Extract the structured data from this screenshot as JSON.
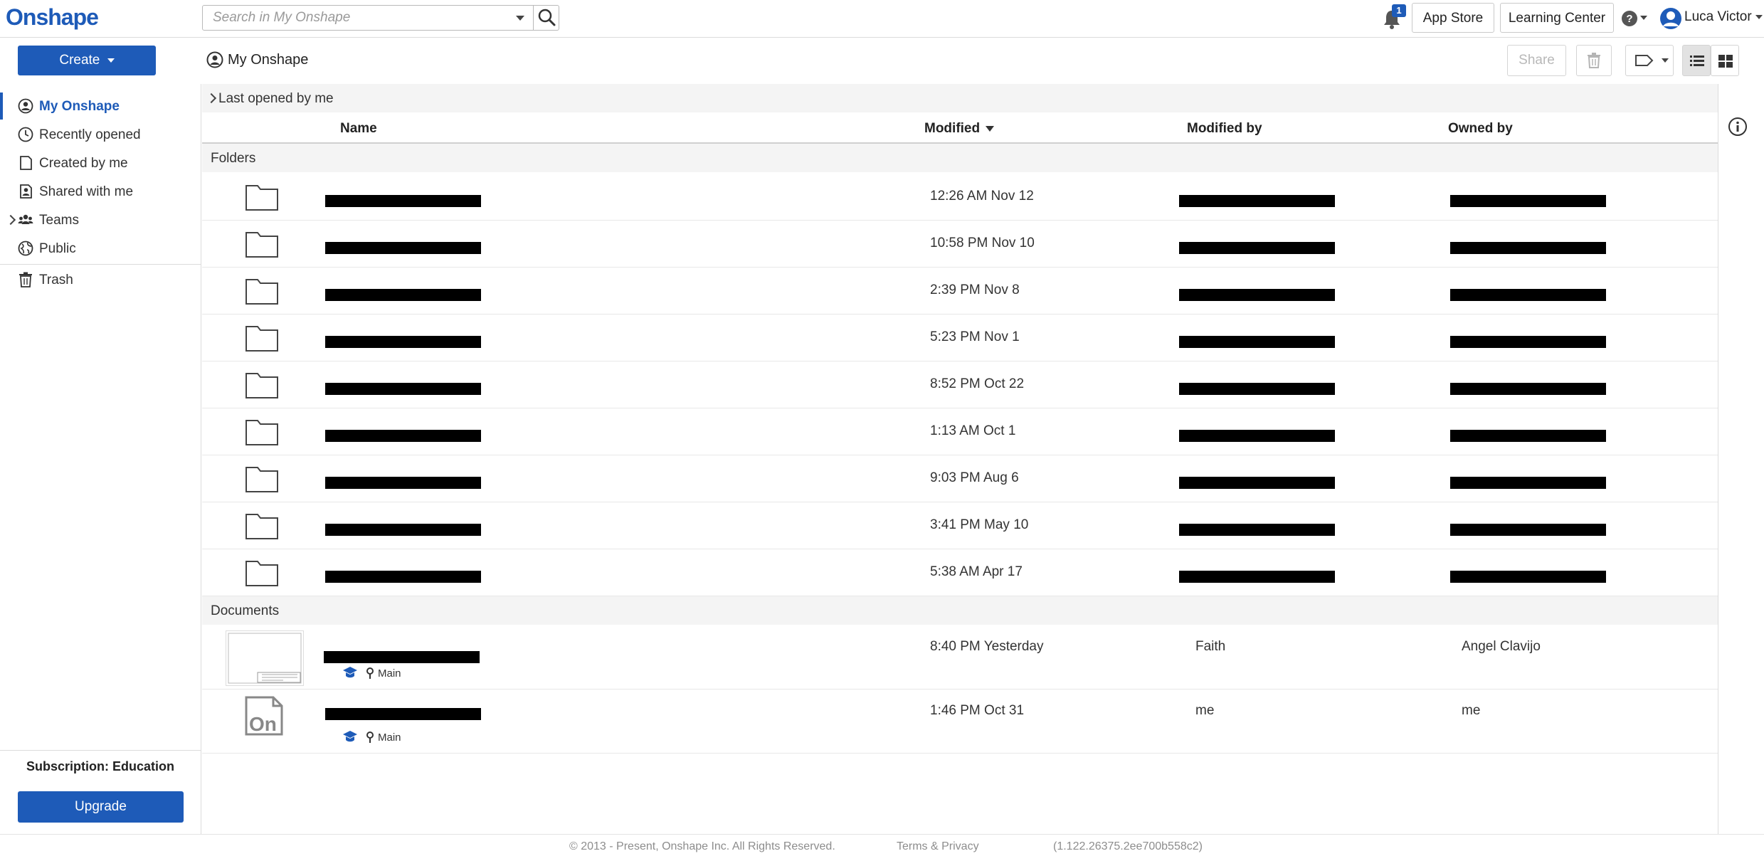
{
  "app": {
    "logo": "Onshape"
  },
  "search": {
    "placeholder": "Search in My Onshape"
  },
  "notifications": {
    "count": "1"
  },
  "header": {
    "app_store": "App Store",
    "learning_center": "Learning Center",
    "user_name": "Luca Victor"
  },
  "toolbar": {
    "create_label": "Create",
    "share_label": "Share"
  },
  "breadcrumb": {
    "label": "My Onshape"
  },
  "sidebar": {
    "items": [
      {
        "label": "My Onshape",
        "icon": "user-circle-icon",
        "active": true
      },
      {
        "label": "Recently opened",
        "icon": "clock-icon"
      },
      {
        "label": "Created by me",
        "icon": "document-icon"
      },
      {
        "label": "Shared with me",
        "icon": "shared-user-icon"
      },
      {
        "label": "Teams",
        "icon": "teams-icon"
      },
      {
        "label": "Public",
        "icon": "globe-icon"
      },
      {
        "label": "Trash",
        "icon": "trash-icon"
      }
    ],
    "subscription": "Subscription: Education",
    "upgrade_label": "Upgrade"
  },
  "main": {
    "last_opened": "Last opened by me",
    "columns": {
      "name": "Name",
      "modified": "Modified",
      "modified_by": "Modified by",
      "owned_by": "Owned by"
    },
    "folders_label": "Folders",
    "documents_label": "Documents",
    "folders": [
      {
        "modified": "12:26 AM Nov 12"
      },
      {
        "modified": "10:58 PM Nov 10"
      },
      {
        "modified": "2:39 PM Nov 8"
      },
      {
        "modified": "5:23 PM Nov 1"
      },
      {
        "modified": "8:52 PM Oct 22"
      },
      {
        "modified": "1:13 AM Oct 1"
      },
      {
        "modified": "9:03 PM Aug 6"
      },
      {
        "modified": "3:41 PM May 10"
      },
      {
        "modified": "5:38 AM Apr 17"
      }
    ],
    "documents": [
      {
        "modified": "8:40 PM Yesterday",
        "modified_by": "Faith",
        "owned_by": "Angel Clavijo",
        "branch": "Main"
      },
      {
        "modified": "1:46 PM Oct 31",
        "modified_by": "me",
        "owned_by": "me",
        "branch": "Main",
        "thumb_text": "On"
      }
    ]
  },
  "footer": {
    "copyright": "© 2013 - Present, Onshape Inc. All Rights Reserved.",
    "terms": "Terms & Privacy",
    "version": "(1.122.26375.2ee700b558c2)"
  },
  "colors": {
    "accent": "#1e5bb8",
    "redaction": "#000000"
  }
}
